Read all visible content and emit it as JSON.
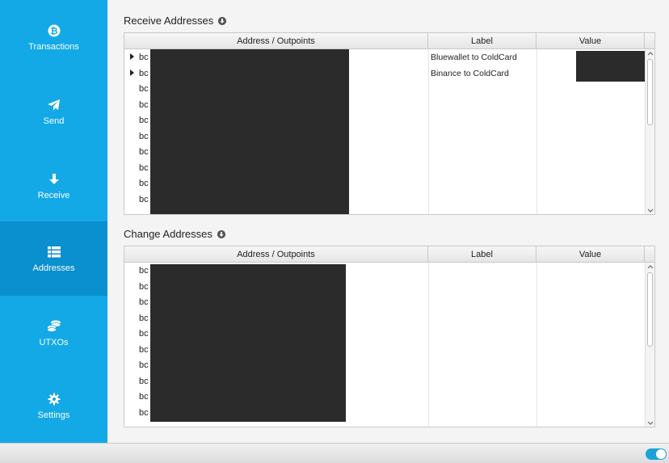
{
  "sidebar": {
    "items": [
      {
        "label": "Transactions",
        "icon": "bitcoin-icon"
      },
      {
        "label": "Send",
        "icon": "paper-plane-icon"
      },
      {
        "label": "Receive",
        "icon": "arrow-down-icon"
      },
      {
        "label": "Addresses",
        "icon": "list-icon",
        "active": true
      },
      {
        "label": "UTXOs",
        "icon": "coins-icon"
      },
      {
        "label": "Settings",
        "icon": "gear-icon"
      }
    ],
    "color": "#12a9e6",
    "active_color": "#0a8fcf"
  },
  "receive": {
    "title": "Receive Addresses",
    "columns": {
      "address": "Address / Outpoints",
      "label": "Label",
      "value": "Value"
    },
    "rows": [
      {
        "address": "bc",
        "label": "Bluewallet to ColdCard",
        "expandable": true
      },
      {
        "address": "bc",
        "label": "Binance to ColdCard",
        "expandable": true
      },
      {
        "address": "bc",
        "label": ""
      },
      {
        "address": "bc",
        "label": ""
      },
      {
        "address": "bc",
        "label": ""
      },
      {
        "address": "bc",
        "label": ""
      },
      {
        "address": "bc",
        "label": ""
      },
      {
        "address": "bc",
        "label": ""
      },
      {
        "address": "bc",
        "label": ""
      },
      {
        "address": "bc",
        "label": ""
      }
    ]
  },
  "change": {
    "title": "Change Addresses",
    "columns": {
      "address": "Address / Outpoints",
      "label": "Label",
      "value": "Value"
    },
    "rows": [
      {
        "address": "bc"
      },
      {
        "address": "bc"
      },
      {
        "address": "bc"
      },
      {
        "address": "bc"
      },
      {
        "address": "bc"
      },
      {
        "address": "bc"
      },
      {
        "address": "bc"
      },
      {
        "address": "bc"
      },
      {
        "address": "bc"
      },
      {
        "address": "bc"
      }
    ]
  },
  "statusbar": {
    "toggle_on": true,
    "toggle_color": "#1aa3d9"
  }
}
